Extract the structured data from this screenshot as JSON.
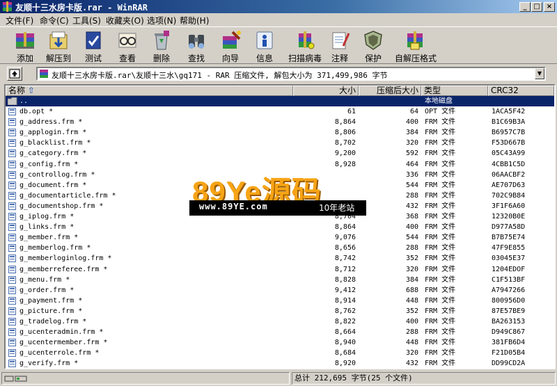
{
  "window": {
    "title": "友顺十三水房卡版.rar - WinRAR"
  },
  "menu": [
    "文件(F)",
    "命令(C)",
    "工具(S)",
    "收藏夹(O)",
    "选项(N)",
    "帮助(H)"
  ],
  "toolbar": [
    "添加",
    "解压到",
    "测试",
    "查看",
    "删除",
    "查找",
    "向导",
    "信息",
    "扫描病毒",
    "注释",
    "保护",
    "自解压格式"
  ],
  "address": {
    "path": "友顺十三水房卡版.rar\\友顺十三水\\gq171 - RAR 压缩文件, 解包大小为 371,499,986 字节"
  },
  "columns": {
    "name": "名称",
    "size": "大小",
    "packed": "压缩后大小",
    "type": "类型",
    "crc": "CRC32"
  },
  "parent_row": {
    "name": "..",
    "type": "本地磁盘"
  },
  "files": [
    {
      "name": "db.opt *",
      "size": "61",
      "packed": "64",
      "type": "OPT 文件",
      "crc": "1ACA5F42"
    },
    {
      "name": "g_address.frm *",
      "size": "8,864",
      "packed": "400",
      "type": "FRM 文件",
      "crc": "B1C69B3A"
    },
    {
      "name": "g_applogin.frm *",
      "size": "8,806",
      "packed": "384",
      "type": "FRM 文件",
      "crc": "B6957C7B"
    },
    {
      "name": "g_blacklist.frm *",
      "size": "8,702",
      "packed": "320",
      "type": "FRM 文件",
      "crc": "F53D667B"
    },
    {
      "name": "g_category.frm *",
      "size": "9,200",
      "packed": "592",
      "type": "FRM 文件",
      "crc": "05C43A99"
    },
    {
      "name": "g_config.frm *",
      "size": "8,928",
      "packed": "464",
      "type": "FRM 文件",
      "crc": "4CBB1C5D"
    },
    {
      "name": "g_controllog.frm *",
      "size": "",
      "packed": "336",
      "type": "FRM 文件",
      "crc": "06AACBF2"
    },
    {
      "name": "g_document.frm *",
      "size": "",
      "packed": "544",
      "type": "FRM 文件",
      "crc": "AE707D63"
    },
    {
      "name": "g_documentarticle.frm *",
      "size": "",
      "packed": "288",
      "type": "FRM 文件",
      "crc": "702C9B84"
    },
    {
      "name": "g_documentshop.frm *",
      "size": "",
      "packed": "432",
      "type": "FRM 文件",
      "crc": "3F1F6A60"
    },
    {
      "name": "g_iplog.frm *",
      "size": "8,704",
      "packed": "368",
      "type": "FRM 文件",
      "crc": "12320B0E"
    },
    {
      "name": "g_links.frm *",
      "size": "8,864",
      "packed": "400",
      "type": "FRM 文件",
      "crc": "D977A58D"
    },
    {
      "name": "g_member.frm *",
      "size": "9,076",
      "packed": "544",
      "type": "FRM 文件",
      "crc": "B7B75E74"
    },
    {
      "name": "g_memberlog.frm *",
      "size": "8,656",
      "packed": "288",
      "type": "FRM 文件",
      "crc": "47F9E855"
    },
    {
      "name": "g_memberloginlog.frm *",
      "size": "8,742",
      "packed": "352",
      "type": "FRM 文件",
      "crc": "03045E37"
    },
    {
      "name": "g_memberreferee.frm *",
      "size": "8,712",
      "packed": "320",
      "type": "FRM 文件",
      "crc": "1204EDOF"
    },
    {
      "name": "g_menu.frm *",
      "size": "8,828",
      "packed": "384",
      "type": "FRM 文件",
      "crc": "C1F513BF"
    },
    {
      "name": "g_order.frm *",
      "size": "9,412",
      "packed": "688",
      "type": "FRM 文件",
      "crc": "A7947266"
    },
    {
      "name": "g_payment.frm *",
      "size": "8,914",
      "packed": "448",
      "type": "FRM 文件",
      "crc": "800956D0"
    },
    {
      "name": "g_picture.frm *",
      "size": "8,762",
      "packed": "352",
      "type": "FRM 文件",
      "crc": "87E57BE9"
    },
    {
      "name": "g_tradelog.frm *",
      "size": "8,822",
      "packed": "400",
      "type": "FRM 文件",
      "crc": "BA263153"
    },
    {
      "name": "g_ucenteradmin.frm *",
      "size": "8,664",
      "packed": "288",
      "type": "FRM 文件",
      "crc": "D949C867"
    },
    {
      "name": "g_ucentermember.frm *",
      "size": "8,940",
      "packed": "448",
      "type": "FRM 文件",
      "crc": "381FB6D4"
    },
    {
      "name": "g_ucenterrole.frm *",
      "size": "8,684",
      "packed": "320",
      "type": "FRM 文件",
      "crc": "F21D05B4"
    },
    {
      "name": "g_verify.frm *",
      "size": "8,920",
      "packed": "432",
      "type": "FRM 文件",
      "crc": "DD99CD2A"
    }
  ],
  "status": {
    "summary": "总计 212,695 字节(25 个文件)"
  },
  "watermark": {
    "logo": "89Ye源码",
    "url": "www.89YE.com",
    "slogan": "10年老站"
  },
  "colors": {
    "selection": "#0a246a",
    "titlebar": "#0a246a",
    "face": "#d4d0c8",
    "watermark": "#f7a416"
  }
}
